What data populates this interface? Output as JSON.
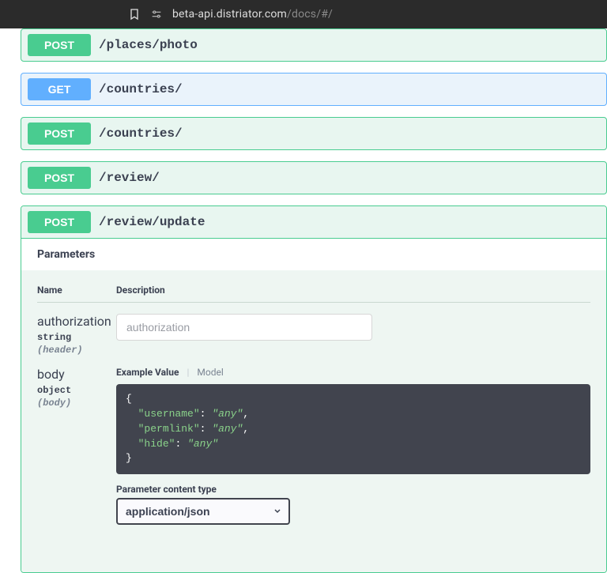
{
  "browser": {
    "url_main": "beta-api.distriator.com",
    "url_path": "/docs/#/"
  },
  "endpoints": [
    {
      "method": "POST",
      "path": "/places/photo"
    },
    {
      "method": "GET",
      "path": "/countries/"
    },
    {
      "method": "POST",
      "path": "/countries/"
    },
    {
      "method": "POST",
      "path": "/review/"
    }
  ],
  "expanded": {
    "method": "POST",
    "path": "/review/update",
    "parameters_label": "Parameters",
    "columns": {
      "name": "Name",
      "description": "Description"
    },
    "params": [
      {
        "name": "authorization",
        "type": "string",
        "location": "(header)",
        "input_placeholder": "authorization"
      },
      {
        "name": "body",
        "type": "object",
        "location": "(body)"
      }
    ],
    "example_tabs": {
      "active": "Example Value",
      "other": "Model"
    },
    "example_json": {
      "keys": [
        "username",
        "permlink",
        "hide"
      ],
      "value": "any"
    },
    "content_type_label": "Parameter content type",
    "content_type_value": "application/json"
  }
}
